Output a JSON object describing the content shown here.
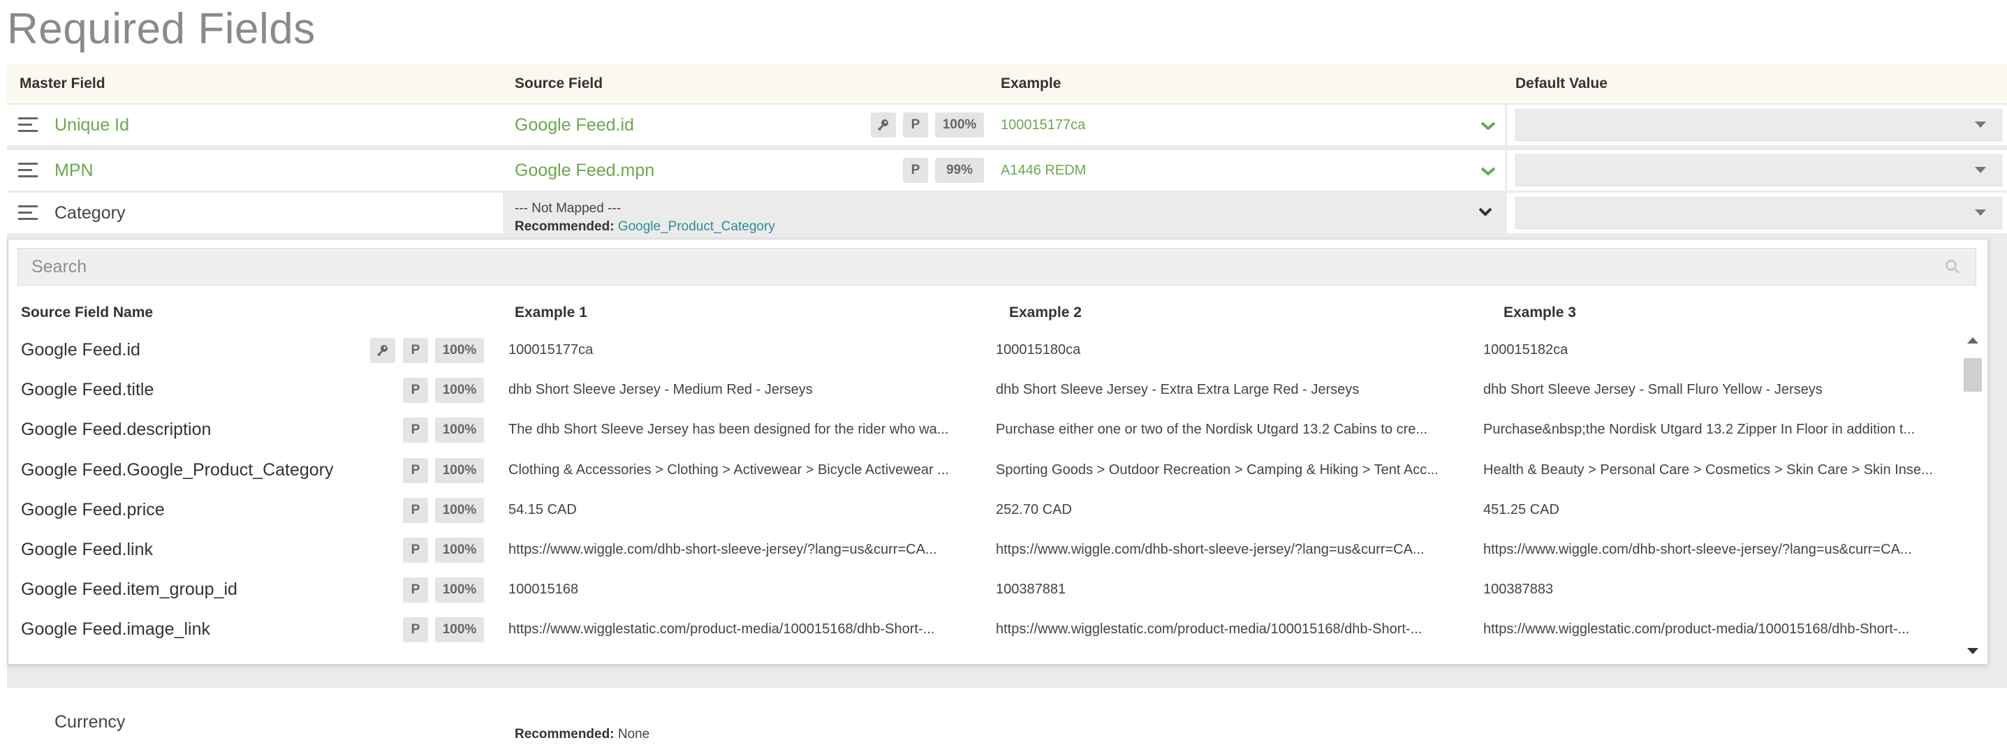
{
  "page": {
    "title": "Required Fields"
  },
  "columns": {
    "master": "Master Field",
    "source": "Source Field",
    "example": "Example",
    "default": "Default Value"
  },
  "rows": [
    {
      "master": "Unique Id",
      "source": "Google Feed.id",
      "key_icon": true,
      "badge_p": "P",
      "coverage": "100%",
      "example": "100015177ca",
      "status": "check-icon"
    },
    {
      "master": "MPN",
      "source": "Google Feed.mpn",
      "key_icon": false,
      "badge_p": "P",
      "coverage": "99%",
      "example": "A1446 REDM",
      "status": "check-icon"
    },
    {
      "master": "Category",
      "not_mapped": "--- Not Mapped ---",
      "recommended_label": "Recommended:",
      "recommended_value": "Google_Product_Category"
    }
  ],
  "dropdown": {
    "search_placeholder": "Search",
    "headers": [
      "Source Field Name",
      "Example 1",
      "Example 2",
      "Example 3"
    ],
    "items": [
      {
        "name": "Google Feed.id",
        "key": true,
        "p": "P",
        "pct": "100%",
        "ex": [
          "100015177ca",
          "100015180ca",
          "100015182ca"
        ]
      },
      {
        "name": "Google Feed.title",
        "key": false,
        "p": "P",
        "pct": "100%",
        "ex": [
          "dhb Short Sleeve Jersey - Medium Red - Jerseys",
          "dhb Short Sleeve Jersey - Extra Extra Large Red - Jerseys",
          "dhb Short Sleeve Jersey - Small Fluro Yellow - Jerseys"
        ]
      },
      {
        "name": "Google Feed.description",
        "key": false,
        "p": "P",
        "pct": "100%",
        "ex": [
          "The dhb Short Sleeve Jersey has been designed for the rider who wa...",
          "Purchase either one or two of the Nordisk Utgard 13.2 Cabins to cre...",
          "Purchase&nbsp;the Nordisk Utgard 13.2 Zipper In Floor in addition t..."
        ]
      },
      {
        "name": "Google Feed.Google_Product_Category",
        "key": false,
        "p": "P",
        "pct": "100%",
        "ex": [
          "Clothing & Accessories > Clothing > Activewear > Bicycle Activewear ...",
          "Sporting Goods > Outdoor Recreation > Camping & Hiking > Tent Acc...",
          "Health & Beauty > Personal Care > Cosmetics > Skin Care > Skin Inse..."
        ]
      },
      {
        "name": "Google Feed.price",
        "key": false,
        "p": "P",
        "pct": "100%",
        "ex": [
          "54.15 CAD",
          "252.70 CAD",
          "451.25 CAD"
        ]
      },
      {
        "name": "Google Feed.link",
        "key": false,
        "p": "P",
        "pct": "100%",
        "ex": [
          "https://www.wiggle.com/dhb-short-sleeve-jersey/?lang=us&curr=CA...",
          "https://www.wiggle.com/dhb-short-sleeve-jersey/?lang=us&curr=CA...",
          "https://www.wiggle.com/dhb-short-sleeve-jersey/?lang=us&curr=CA..."
        ]
      },
      {
        "name": "Google Feed.item_group_id",
        "key": false,
        "p": "P",
        "pct": "100%",
        "ex": [
          "100015168",
          "100387881",
          "100387883"
        ]
      },
      {
        "name": "Google Feed.image_link",
        "key": false,
        "p": "P",
        "pct": "100%",
        "ex": [
          "https://www.wigglestatic.com/product-media/100015168/dhb-Short-...",
          "https://www.wigglestatic.com/product-media/100015168/dhb-Short-...",
          "https://www.wigglestatic.com/product-media/100015168/dhb-Short-..."
        ]
      }
    ]
  },
  "under_row": {
    "master": "Currency",
    "recommended_label": "Recommended:",
    "recommended_value": "None"
  },
  "colors": {
    "mapped_green": "#6aa84f",
    "header_bg": "#fbf8ef",
    "recommended_link": "#2e8a9a"
  }
}
